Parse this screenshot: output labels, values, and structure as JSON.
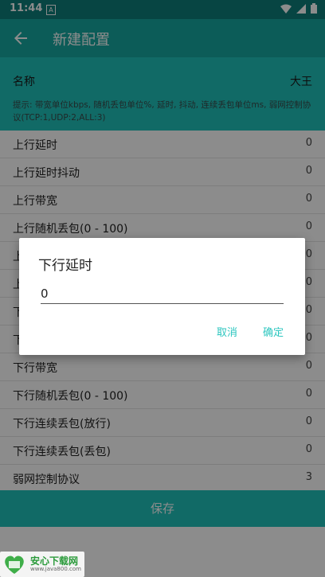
{
  "status_bar": {
    "time": "11:44",
    "sim_glyph": "A"
  },
  "app_bar": {
    "title": "新建配置"
  },
  "name_field": {
    "label": "名称",
    "value": "大王"
  },
  "hint": "提示: 带宽单位kbps, 随机丢包单位%, 延时, 抖动, 连续丢包单位ms, 弱网控制协议(TCP:1,UDP:2,ALL:3)",
  "rows": [
    {
      "label": "上行延时",
      "value": "0"
    },
    {
      "label": "上行延时抖动",
      "value": "0"
    },
    {
      "label": "上行带宽",
      "value": "0"
    },
    {
      "label": "上行随机丢包(0 - 100)",
      "value": "0"
    },
    {
      "label": "上",
      "value": "0"
    },
    {
      "label": "上",
      "value": "0"
    },
    {
      "label": "下",
      "value": "0"
    },
    {
      "label": "下",
      "value": "0"
    },
    {
      "label": "下行带宽",
      "value": "0"
    },
    {
      "label": "下行随机丢包(0 - 100)",
      "value": "0"
    },
    {
      "label": "下行连续丢包(放行)",
      "value": "0"
    },
    {
      "label": "下行连续丢包(丢包)",
      "value": "0"
    },
    {
      "label": "弱网控制协议",
      "value": "3"
    }
  ],
  "save_button": "保存",
  "dialog": {
    "title": "下行延时",
    "input_value": "0",
    "cancel": "取消",
    "confirm": "确定"
  },
  "watermark": {
    "name": "安心下载网",
    "url": "www.java800.com"
  }
}
